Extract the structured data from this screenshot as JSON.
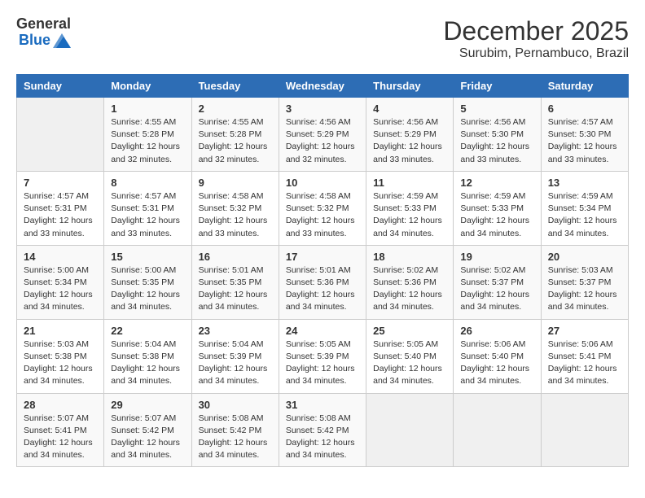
{
  "logo": {
    "general": "General",
    "blue": "Blue"
  },
  "title": "December 2025",
  "subtitle": "Surubim, Pernambuco, Brazil",
  "days_header": [
    "Sunday",
    "Monday",
    "Tuesday",
    "Wednesday",
    "Thursday",
    "Friday",
    "Saturday"
  ],
  "weeks": [
    [
      {
        "day": "",
        "info": ""
      },
      {
        "day": "1",
        "info": "Sunrise: 4:55 AM\nSunset: 5:28 PM\nDaylight: 12 hours\nand 32 minutes."
      },
      {
        "day": "2",
        "info": "Sunrise: 4:55 AM\nSunset: 5:28 PM\nDaylight: 12 hours\nand 32 minutes."
      },
      {
        "day": "3",
        "info": "Sunrise: 4:56 AM\nSunset: 5:29 PM\nDaylight: 12 hours\nand 32 minutes."
      },
      {
        "day": "4",
        "info": "Sunrise: 4:56 AM\nSunset: 5:29 PM\nDaylight: 12 hours\nand 33 minutes."
      },
      {
        "day": "5",
        "info": "Sunrise: 4:56 AM\nSunset: 5:30 PM\nDaylight: 12 hours\nand 33 minutes."
      },
      {
        "day": "6",
        "info": "Sunrise: 4:57 AM\nSunset: 5:30 PM\nDaylight: 12 hours\nand 33 minutes."
      }
    ],
    [
      {
        "day": "7",
        "info": "Sunrise: 4:57 AM\nSunset: 5:31 PM\nDaylight: 12 hours\nand 33 minutes."
      },
      {
        "day": "8",
        "info": "Sunrise: 4:57 AM\nSunset: 5:31 PM\nDaylight: 12 hours\nand 33 minutes."
      },
      {
        "day": "9",
        "info": "Sunrise: 4:58 AM\nSunset: 5:32 PM\nDaylight: 12 hours\nand 33 minutes."
      },
      {
        "day": "10",
        "info": "Sunrise: 4:58 AM\nSunset: 5:32 PM\nDaylight: 12 hours\nand 33 minutes."
      },
      {
        "day": "11",
        "info": "Sunrise: 4:59 AM\nSunset: 5:33 PM\nDaylight: 12 hours\nand 34 minutes."
      },
      {
        "day": "12",
        "info": "Sunrise: 4:59 AM\nSunset: 5:33 PM\nDaylight: 12 hours\nand 34 minutes."
      },
      {
        "day": "13",
        "info": "Sunrise: 4:59 AM\nSunset: 5:34 PM\nDaylight: 12 hours\nand 34 minutes."
      }
    ],
    [
      {
        "day": "14",
        "info": "Sunrise: 5:00 AM\nSunset: 5:34 PM\nDaylight: 12 hours\nand 34 minutes."
      },
      {
        "day": "15",
        "info": "Sunrise: 5:00 AM\nSunset: 5:35 PM\nDaylight: 12 hours\nand 34 minutes."
      },
      {
        "day": "16",
        "info": "Sunrise: 5:01 AM\nSunset: 5:35 PM\nDaylight: 12 hours\nand 34 minutes."
      },
      {
        "day": "17",
        "info": "Sunrise: 5:01 AM\nSunset: 5:36 PM\nDaylight: 12 hours\nand 34 minutes."
      },
      {
        "day": "18",
        "info": "Sunrise: 5:02 AM\nSunset: 5:36 PM\nDaylight: 12 hours\nand 34 minutes."
      },
      {
        "day": "19",
        "info": "Sunrise: 5:02 AM\nSunset: 5:37 PM\nDaylight: 12 hours\nand 34 minutes."
      },
      {
        "day": "20",
        "info": "Sunrise: 5:03 AM\nSunset: 5:37 PM\nDaylight: 12 hours\nand 34 minutes."
      }
    ],
    [
      {
        "day": "21",
        "info": "Sunrise: 5:03 AM\nSunset: 5:38 PM\nDaylight: 12 hours\nand 34 minutes."
      },
      {
        "day": "22",
        "info": "Sunrise: 5:04 AM\nSunset: 5:38 PM\nDaylight: 12 hours\nand 34 minutes."
      },
      {
        "day": "23",
        "info": "Sunrise: 5:04 AM\nSunset: 5:39 PM\nDaylight: 12 hours\nand 34 minutes."
      },
      {
        "day": "24",
        "info": "Sunrise: 5:05 AM\nSunset: 5:39 PM\nDaylight: 12 hours\nand 34 minutes."
      },
      {
        "day": "25",
        "info": "Sunrise: 5:05 AM\nSunset: 5:40 PM\nDaylight: 12 hours\nand 34 minutes."
      },
      {
        "day": "26",
        "info": "Sunrise: 5:06 AM\nSunset: 5:40 PM\nDaylight: 12 hours\nand 34 minutes."
      },
      {
        "day": "27",
        "info": "Sunrise: 5:06 AM\nSunset: 5:41 PM\nDaylight: 12 hours\nand 34 minutes."
      }
    ],
    [
      {
        "day": "28",
        "info": "Sunrise: 5:07 AM\nSunset: 5:41 PM\nDaylight: 12 hours\nand 34 minutes."
      },
      {
        "day": "29",
        "info": "Sunrise: 5:07 AM\nSunset: 5:42 PM\nDaylight: 12 hours\nand 34 minutes."
      },
      {
        "day": "30",
        "info": "Sunrise: 5:08 AM\nSunset: 5:42 PM\nDaylight: 12 hours\nand 34 minutes."
      },
      {
        "day": "31",
        "info": "Sunrise: 5:08 AM\nSunset: 5:42 PM\nDaylight: 12 hours\nand 34 minutes."
      },
      {
        "day": "",
        "info": ""
      },
      {
        "day": "",
        "info": ""
      },
      {
        "day": "",
        "info": ""
      }
    ]
  ]
}
